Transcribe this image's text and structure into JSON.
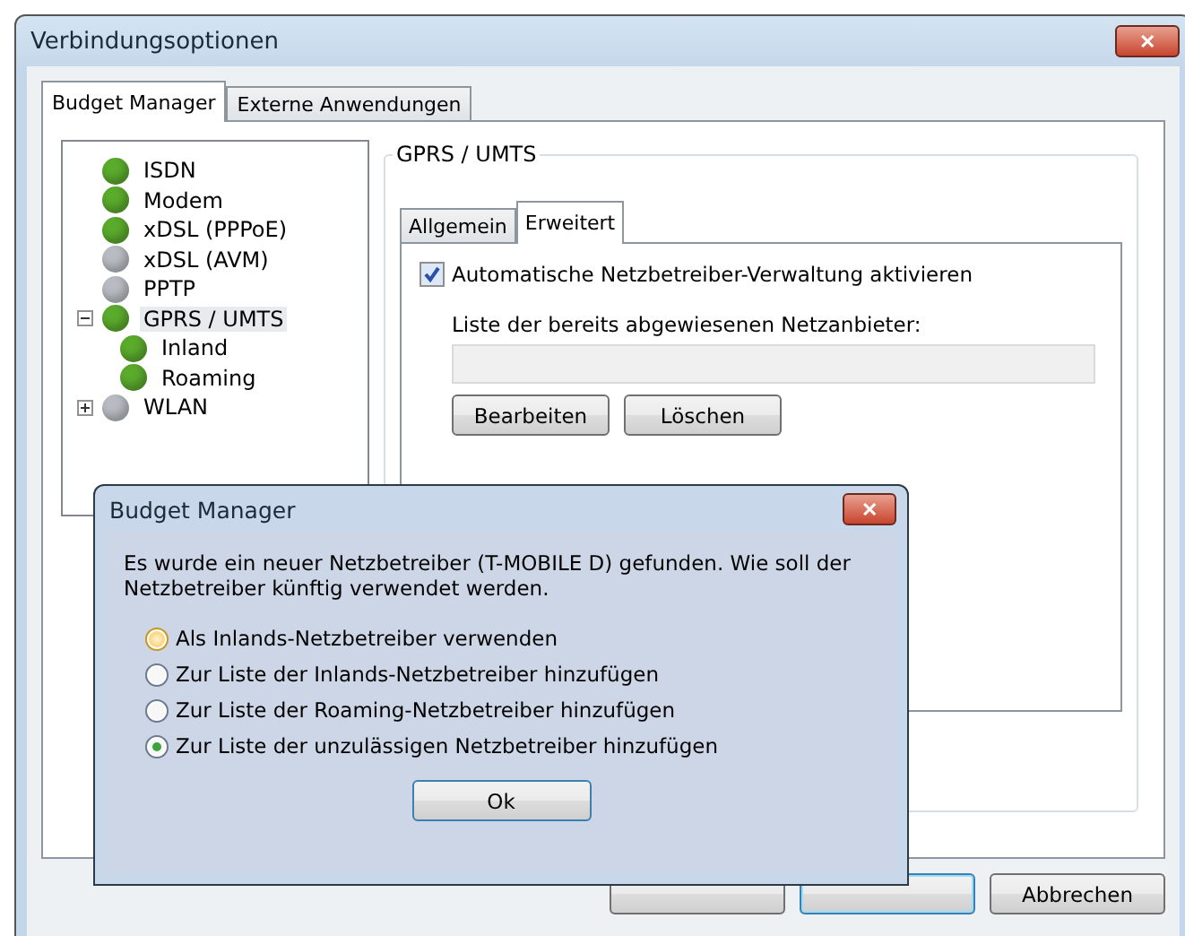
{
  "window": {
    "title": "Verbindungsoptionen",
    "close": "✕"
  },
  "tabs": [
    {
      "label": "Budget Manager",
      "selected": true
    },
    {
      "label": "Externe Anwendungen",
      "selected": false
    }
  ],
  "tree": [
    {
      "label": "ISDN",
      "color": "#5aaa2c"
    },
    {
      "label": "Modem",
      "color": "#5aaa2c"
    },
    {
      "label": "xDSL (PPPoE)",
      "color": "#5aaa2c"
    },
    {
      "label": "xDSL (AVM)",
      "color": "#b8bcc2"
    },
    {
      "label": "PPTP",
      "color": "#b8bcc2"
    },
    {
      "label": "GPRS / UMTS",
      "color": "#5aaa2c",
      "expanded": true,
      "selected": true,
      "children": [
        {
          "label": "Inland",
          "color": "#5aaa2c"
        },
        {
          "label": "Roaming",
          "color": "#5aaa2c"
        }
      ]
    },
    {
      "label": "WLAN",
      "color": "#b8bcc2",
      "expanded": false
    }
  ],
  "group": {
    "title": "GPRS / UMTS",
    "tabs": [
      {
        "label": "Allgemein",
        "selected": false
      },
      {
        "label": "Erweitert",
        "selected": true
      }
    ],
    "checkbox": {
      "label": "Automatische Netzbetreiber-Verwaltung aktivieren",
      "checked": true
    },
    "list_label": "Liste der bereits abgewiesenen Netzanbieter:",
    "buttons": [
      "Bearbeiten",
      "Löschen"
    ]
  },
  "footer_buttons": [
    "Abbrechen"
  ],
  "dialog": {
    "title": "Budget Manager",
    "close": "✕",
    "message": "Es wurde ein neuer Netzbetreiber (T-MOBILE D) gefunden. Wie soll der Netzbetreiber künftig verwendet werden.",
    "options": [
      {
        "label": "Als Inlands-Netzbetreiber verwenden",
        "selected": false,
        "hover": true
      },
      {
        "label": "Zur Liste der Inlands-Netzbetreiber hinzufügen",
        "selected": false,
        "hover": false
      },
      {
        "label": "Zur Liste der Roaming-Netzbetreiber hinzufügen",
        "selected": false,
        "hover": false
      },
      {
        "label": "Zur Liste der unzulässigen Netzbetreiber hinzufügen",
        "selected": true,
        "hover": false
      }
    ],
    "button": "Ok"
  }
}
